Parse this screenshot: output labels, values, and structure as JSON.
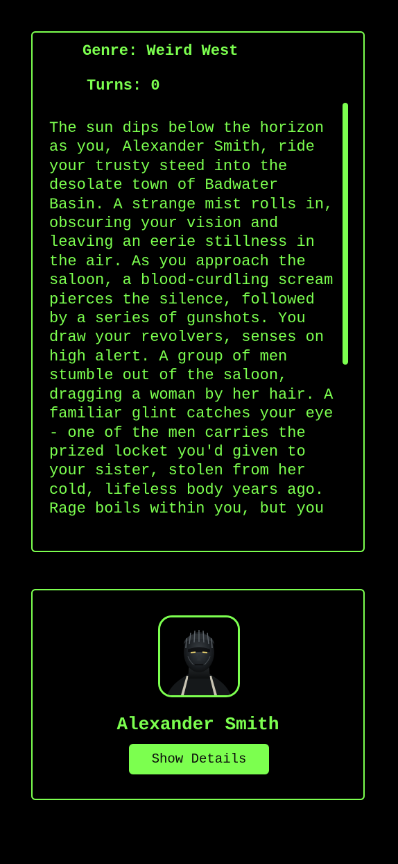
{
  "story": {
    "genre_line": "Genre: Weird West",
    "turns_line": "Turns: 0",
    "text": "The sun dips below the horizon as you, Alexander Smith, ride your trusty steed into the desolate town of Badwater Basin. A strange mist rolls in, obscuring your vision and leaving an eerie stillness in the air. As you approach the saloon, a blood-curdling scream pierces the silence, followed by a series of gunshots. You draw your revolvers, senses on high alert. A group of men stumble out of the saloon, dragging a woman by her hair. A familiar glint catches your eye - one of the men carries the prized locket you'd given to your sister, stolen from her cold, lifeless body years ago. Rage boils within you, but you"
  },
  "character": {
    "avatar_icon": "character-portrait",
    "name": "Alexander Smith",
    "details_button_label": "Show Details"
  },
  "theme": {
    "accent": "#7cff4f",
    "background": "#000000",
    "button_text": "#0a0a0a"
  }
}
